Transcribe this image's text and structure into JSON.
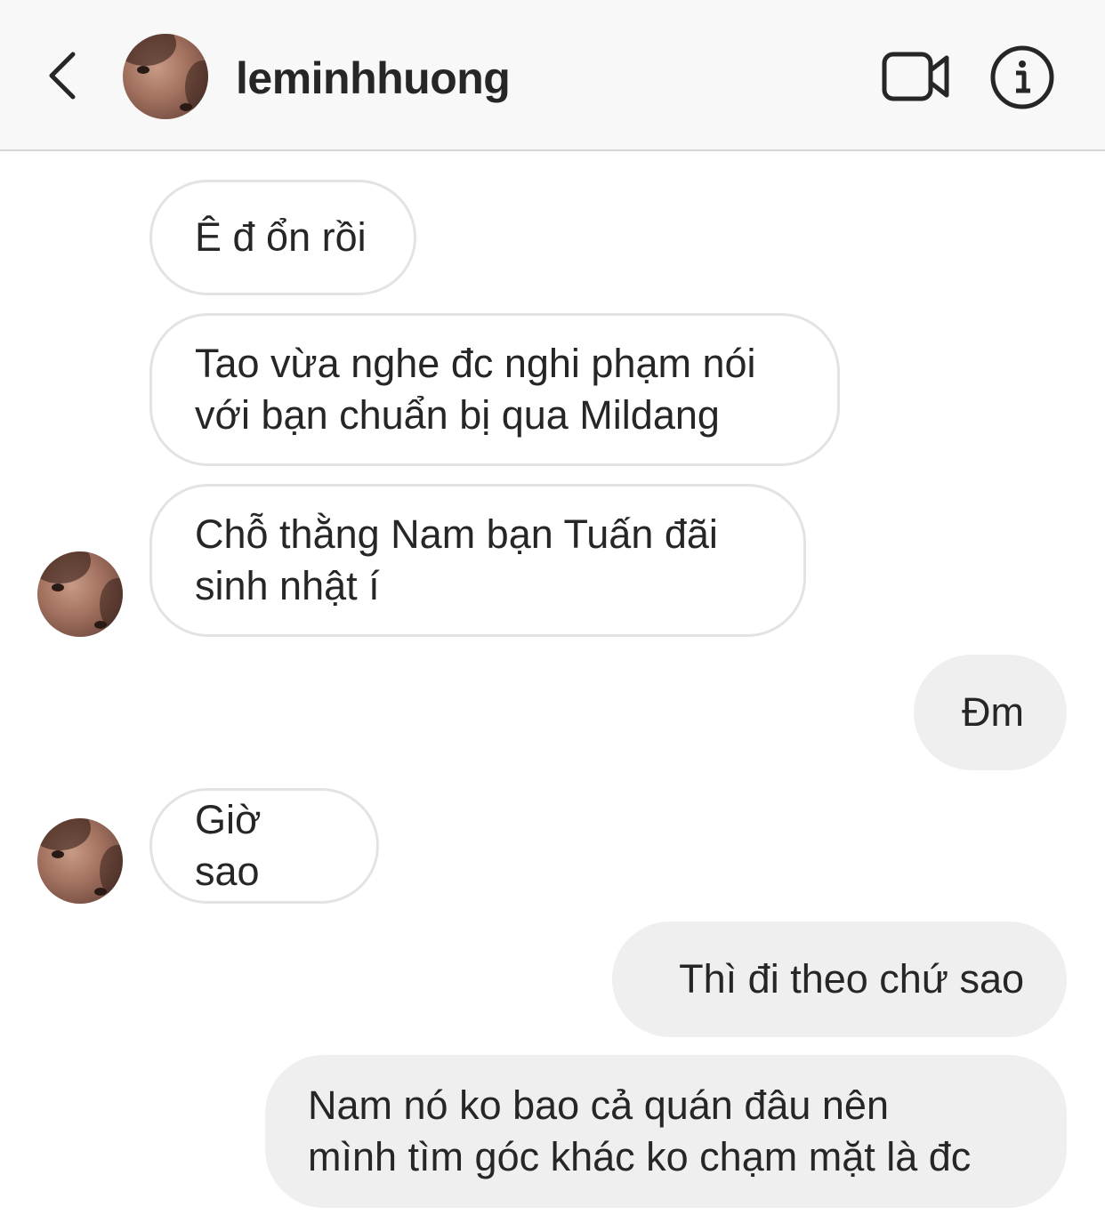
{
  "header": {
    "username": "leminhhuong",
    "back_icon": "chevron-left-icon",
    "video_icon": "video-camera-icon",
    "info_icon": "info-icon"
  },
  "messages": [
    {
      "direction": "incoming",
      "text": "Ê đ ổn rồi"
    },
    {
      "direction": "incoming",
      "text": "Tao vừa nghe đc nghi phạm nói\nvới bạn chuẩn bị qua Mildang"
    },
    {
      "direction": "incoming",
      "text": "Chỗ thằng Nam bạn Tuấn đãi\nsinh nhật í"
    },
    {
      "direction": "outgoing",
      "text": "Đm"
    },
    {
      "direction": "incoming",
      "text": "Giờ sao"
    },
    {
      "direction": "outgoing",
      "text": "Thì đi theo chứ sao"
    },
    {
      "direction": "outgoing",
      "text": "Nam nó ko bao cả quán đâu nên\nmình tìm góc khác ko chạm mặt là đc"
    }
  ],
  "colors": {
    "header_bg": "#f8f8f8",
    "outgoing_bubble": "#efefef",
    "incoming_border": "#e3e3e3",
    "text": "#262626"
  }
}
